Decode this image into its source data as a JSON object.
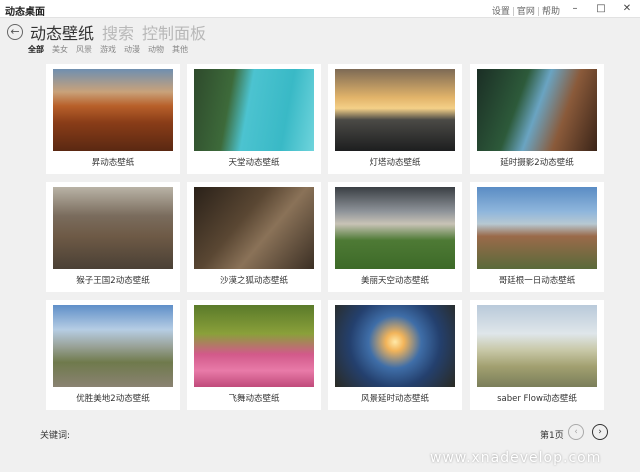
{
  "app": {
    "title": "动态桌面"
  },
  "top_links": [
    "设置",
    "官网",
    "帮助"
  ],
  "window_controls": {
    "minimize": "–",
    "maximize": "□",
    "close": "✕"
  },
  "nav": {
    "back_glyph": "←",
    "tabs": [
      "动态壁纸",
      "搜索",
      "控制面板"
    ],
    "categories": [
      "全部",
      "美女",
      "风景",
      "游戏",
      "动漫",
      "动物",
      "其他"
    ]
  },
  "wallpapers": [
    "昇动态壁纸",
    "天堂动态壁纸",
    "灯塔动态壁纸",
    "延时摄影2动态壁纸",
    "猴子王国2动态壁纸",
    "沙漠之狐动态壁纸",
    "美丽天空动态壁纸",
    "哥廷根一日动态壁纸",
    "优胜美地2动态壁纸",
    "飞舞动态壁纸",
    "风景延时动态壁纸",
    "saber Flow动态壁纸"
  ],
  "footer": {
    "keyword_label": "关键词:",
    "page_label": "第1页",
    "prev_glyph": "‹",
    "next_glyph": "›"
  },
  "watermark": "www.xnadevelop.com"
}
